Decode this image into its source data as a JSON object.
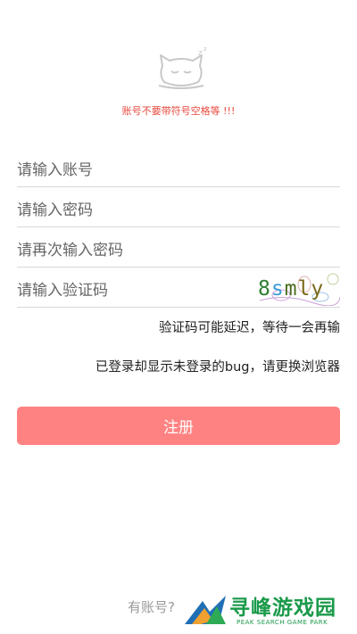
{
  "header": {
    "mascot_icon": "sleeping-cat-icon",
    "warning_text": "账号不要带符号空格等 !!!",
    "warning_color": "#e8493f"
  },
  "form": {
    "account_placeholder": "请输入账号",
    "password_placeholder": "请输入密码",
    "confirm_placeholder": "请再次输入密码",
    "captcha_placeholder": "请输入验证码",
    "captcha_chars": [
      "8",
      "s",
      "m",
      "ly"
    ]
  },
  "notes": {
    "captcha_delay": "验证码可能延迟，等待一会再输",
    "bug_hint": "已登录却显示未登录的bug，请更换浏览器"
  },
  "register_button": {
    "label": "注册",
    "color": "#ff8282"
  },
  "footer": {
    "login_link": "有账号?"
  },
  "watermark": {
    "cn": "寻峰游戏园",
    "en": "PEAK SEARCH GAME PARK"
  }
}
